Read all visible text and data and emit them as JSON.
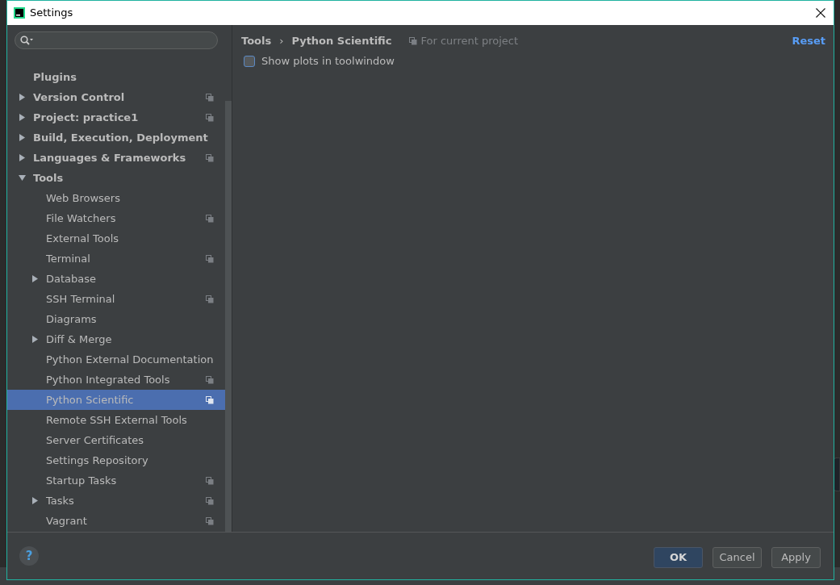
{
  "window": {
    "title": "Settings"
  },
  "tree": [
    {
      "label": "Plugins",
      "project_scoped": false,
      "selected": false
    },
    {
      "label": "Version Control",
      "expanded": false,
      "project_scoped": true,
      "selected": false
    },
    {
      "label": "Project: practice1",
      "expanded": false,
      "project_scoped": true,
      "selected": false
    },
    {
      "label": "Build, Execution, Deployment",
      "expanded": false,
      "project_scoped": false,
      "selected": false
    },
    {
      "label": "Languages & Frameworks",
      "expanded": false,
      "project_scoped": true,
      "selected": false
    },
    {
      "label": "Tools",
      "expanded": true,
      "project_scoped": false,
      "selected": false,
      "children": [
        {
          "label": "Web Browsers",
          "project_scoped": false,
          "selected": false
        },
        {
          "label": "File Watchers",
          "project_scoped": true,
          "selected": false
        },
        {
          "label": "External Tools",
          "project_scoped": false,
          "selected": false
        },
        {
          "label": "Terminal",
          "project_scoped": true,
          "selected": false
        },
        {
          "label": "Database",
          "expanded": false,
          "project_scoped": false,
          "selected": false
        },
        {
          "label": "SSH Terminal",
          "project_scoped": true,
          "selected": false
        },
        {
          "label": "Diagrams",
          "project_scoped": false,
          "selected": false
        },
        {
          "label": "Diff & Merge",
          "expanded": false,
          "project_scoped": false,
          "selected": false
        },
        {
          "label": "Python External Documentation",
          "project_scoped": false,
          "selected": false
        },
        {
          "label": "Python Integrated Tools",
          "project_scoped": true,
          "selected": false
        },
        {
          "label": "Python Scientific",
          "project_scoped": true,
          "selected": true
        },
        {
          "label": "Remote SSH External Tools",
          "project_scoped": false,
          "selected": false
        },
        {
          "label": "Server Certificates",
          "project_scoped": false,
          "selected": false
        },
        {
          "label": "Settings Repository",
          "project_scoped": false,
          "selected": false
        },
        {
          "label": "Startup Tasks",
          "project_scoped": true,
          "selected": false
        },
        {
          "label": "Tasks",
          "expanded": false,
          "project_scoped": true,
          "selected": false
        },
        {
          "label": "Vagrant",
          "project_scoped": true,
          "selected": false
        }
      ]
    }
  ],
  "breadcrumb": [
    "Tools",
    "›",
    "Python Scientific"
  ],
  "scope_note": "For current project",
  "reset_link": "Reset",
  "options": [
    {
      "label": "Show plots in toolwindow",
      "checked": false
    }
  ],
  "help_button": "?",
  "buttons": [
    {
      "label": "OK",
      "default": true
    },
    {
      "label": "Cancel",
      "default": false
    },
    {
      "label": "Apply",
      "default": false
    }
  ]
}
